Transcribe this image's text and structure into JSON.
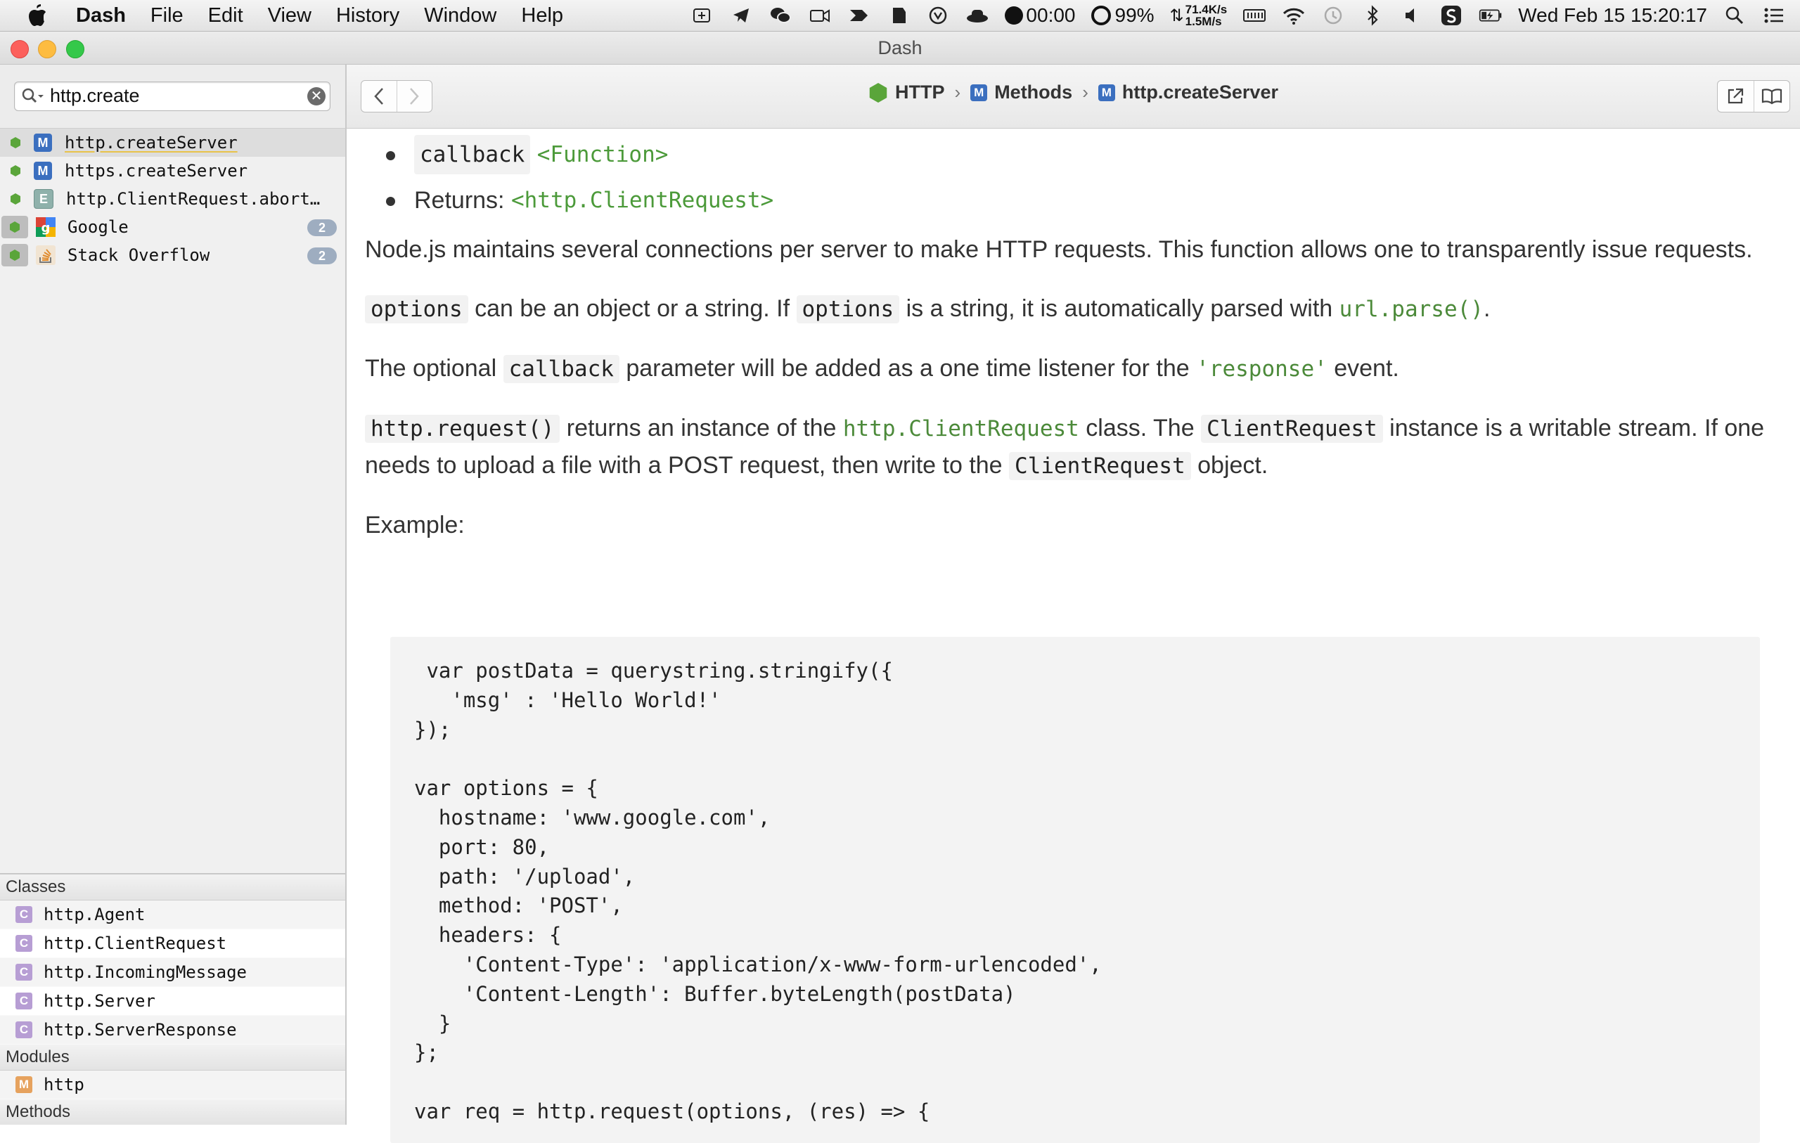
{
  "menubar": {
    "app_name": "Dash",
    "menus": [
      "File",
      "Edit",
      "View",
      "History",
      "Window",
      "Help"
    ],
    "timer": "00:00",
    "battery_percent": "99%",
    "net_up": "71.4K/s",
    "net_down": "1.5M/s",
    "datetime": "Wed Feb 15  15:20:17"
  },
  "window": {
    "title": "Dash"
  },
  "search": {
    "query": "http.create"
  },
  "results": [
    {
      "label": "http.createServer",
      "kind": "M"
    },
    {
      "label": "https.createServer",
      "kind": "M"
    },
    {
      "label": "http.ClientRequest.abort…",
      "kind": "E"
    },
    {
      "label": "Google",
      "count": "2"
    },
    {
      "label": "Stack Overflow",
      "count": "2"
    }
  ],
  "toc": {
    "classes_header": "Classes",
    "classes": [
      "http.Agent",
      "http.ClientRequest",
      "http.IncomingMessage",
      "http.Server",
      "http.ServerResponse"
    ],
    "modules_header": "Modules",
    "modules": [
      "http"
    ],
    "methods_header": "Methods",
    "class_badge": "C",
    "module_badge": "M"
  },
  "breadcrumb": {
    "docset": "HTTP",
    "section": "Methods",
    "page": "http.createServer",
    "section_badge": "M",
    "page_badge": "M"
  },
  "doc": {
    "bullet1_code": "callback",
    "bullet1_type": "<Function>",
    "bullet2_label": "Returns:",
    "bullet2_type": "<http.ClientRequest>",
    "p1": "Node.js maintains several connections per server to make HTTP requests. This function allows one to transparently issue requests.",
    "p2_code1": "options",
    "p2_text1": "can be an object or a string. If",
    "p2_code2": "options",
    "p2_text2": "is a string, it is automatically parsed with",
    "p2_link": "url.parse()",
    "p2_end": ".",
    "p3_text1": "The optional",
    "p3_code": "callback",
    "p3_text2": "parameter will be added as a one time listener for the",
    "p3_str": "'response'",
    "p3_text3": "event.",
    "p4_code1": "http.request()",
    "p4_text1": "returns an instance of the",
    "p4_link": "http.ClientRequest",
    "p4_text2": "class. The",
    "p4_code2": "ClientRequest",
    "p4_text3": "instance is a writable stream. If one needs to upload a file with a POST request, then write to the",
    "p4_code3": "ClientRequest",
    "p4_text4": "object.",
    "example_label": "Example:",
    "code": " var postData = querystring.stringify({\n   'msg' : 'Hello World!'\n});\n\nvar options = {\n  hostname: 'www.google.com',\n  port: 80,\n  path: '/upload',\n  method: 'POST',\n  headers: {\n    'Content-Type': 'application/x-www-form-urlencoded',\n    'Content-Length': Buffer.byteLength(postData)\n  }\n};\n\nvar req = http.request(options, (res) => {"
  }
}
